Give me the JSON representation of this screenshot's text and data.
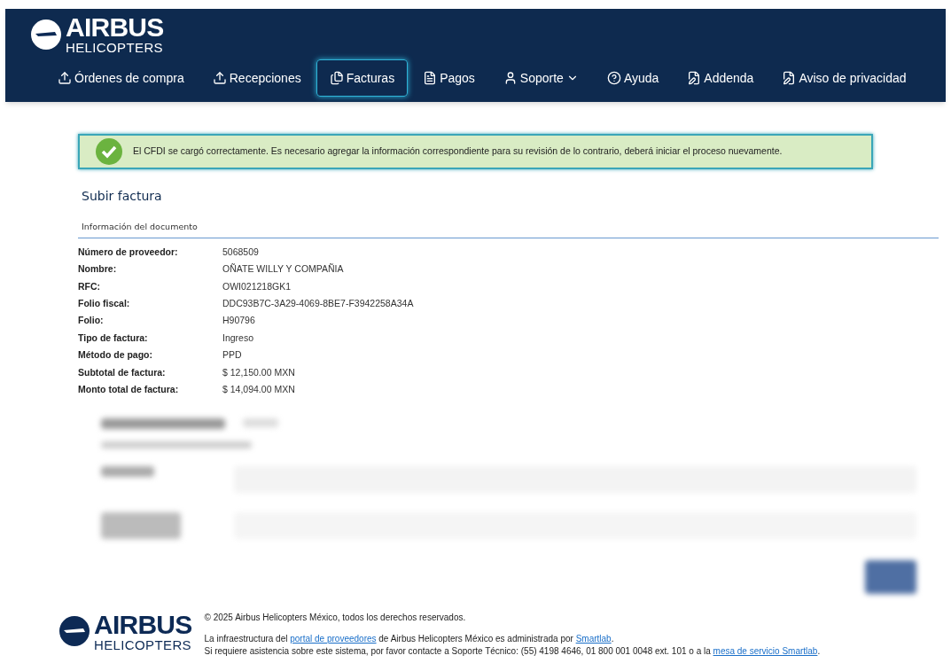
{
  "header": {
    "logo": {
      "name": "AIRBUS",
      "sub": "HELICOPTERS"
    },
    "nav": [
      {
        "label": "Órdenes de compra",
        "selected": false,
        "dropdown": false
      },
      {
        "label": "Recepciones",
        "selected": false,
        "dropdown": false
      },
      {
        "label": "Facturas",
        "selected": true,
        "dropdown": false
      },
      {
        "label": "Pagos",
        "selected": false,
        "dropdown": false
      },
      {
        "label": "Soporte",
        "selected": false,
        "dropdown": true
      },
      {
        "label": "Ayuda",
        "selected": false,
        "dropdown": false
      },
      {
        "label": "Addenda",
        "selected": false,
        "dropdown": false
      },
      {
        "label": "Aviso de privacidad",
        "selected": false,
        "dropdown": false
      }
    ]
  },
  "alert": {
    "kind": "success",
    "message": "El CFDI se cargó correctamente. Es necesario agregar la información correspondiente para su revisión de lo contrario, deberá iniciar el proceso nuevamente."
  },
  "page_title": "Subir factura",
  "section_title": "Información del documento",
  "fields": [
    {
      "label": "Número de proveedor:",
      "value": "5068509"
    },
    {
      "label": "Nombre:",
      "value": "OÑATE WILLY Y COMPAÑIA"
    },
    {
      "label": "RFC:",
      "value": "OWI021218GK1"
    },
    {
      "label": "Folio fiscal:",
      "value": "DDC93B7C-3A29-4069-8BE7-F3942258A34A"
    },
    {
      "label": "Folio:",
      "value": "H90796"
    },
    {
      "label": "Tipo de factura:",
      "value": "Ingreso"
    },
    {
      "label": "Método de pago:",
      "value": "PPD"
    },
    {
      "label": "Subtotal de factura:",
      "value": "$ 12,150.00 MXN"
    },
    {
      "label": "Monto total de factura:",
      "value": "$ 14,094.00 MXN"
    }
  ],
  "footer": {
    "logo": {
      "name": "AIRBUS",
      "sub": "HELICOPTERS"
    },
    "lines": [
      [
        {
          "text": "© 2025 Airbus Helicopters México, todos los derechos reservados.",
          "link": false
        }
      ],
      [
        {
          "text": "La infraestructura del ",
          "link": false
        },
        {
          "text": "portal de proveedores",
          "link": true
        },
        {
          "text": " de Airbus Helicopters México es administrada por ",
          "link": false
        },
        {
          "text": "Smartlab",
          "link": true
        },
        {
          "text": ".",
          "link": false
        }
      ],
      [
        {
          "text": "Si requiere asistencia sobre este sistema, por favor contacte a Soporte Técnico: (55) 4198 4646, 01 800 001 0048 ext. 101 o a la ",
          "link": false
        },
        {
          "text": "mesa de servicio Smartlab",
          "link": true
        },
        {
          "text": ".",
          "link": false
        }
      ]
    ]
  }
}
